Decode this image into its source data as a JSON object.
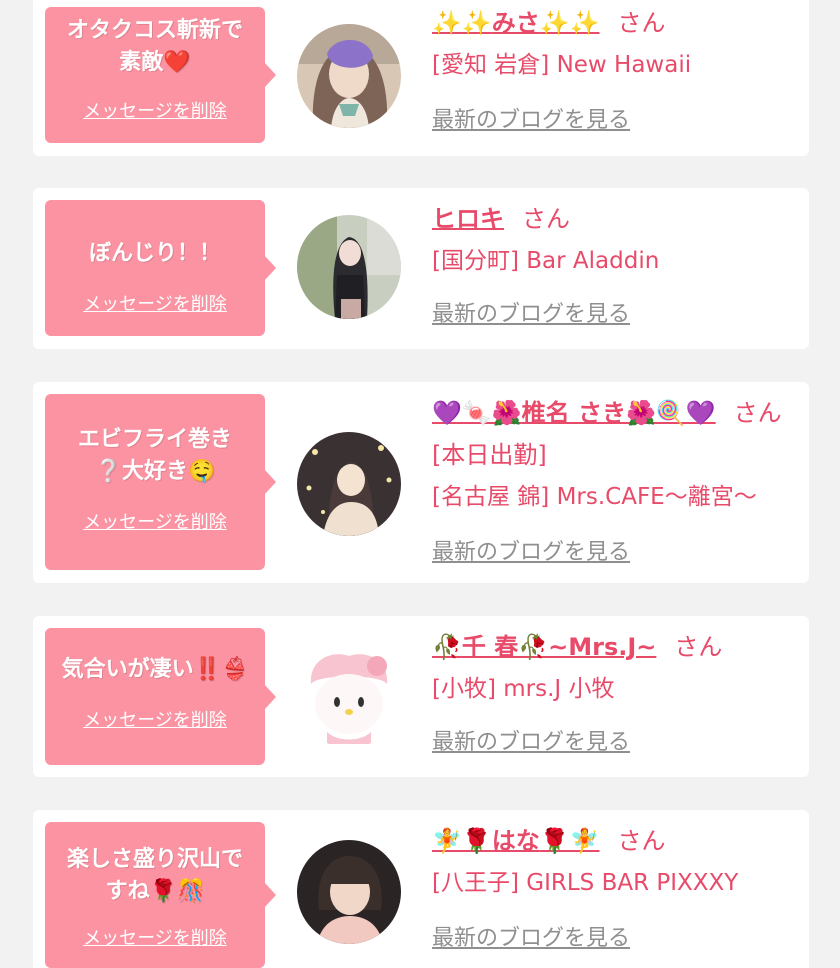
{
  "messages": [
    {
      "bubble_text": "オタクコス斬新で素敵❤️",
      "delete_label": "メッセージを削除",
      "name_pre": "✨✨",
      "name": "みさ",
      "name_post": "✨✨",
      "honorific": "さん",
      "status": "",
      "shop": "[愛知 岩倉] New Hawaii",
      "blog_label": "最新のブログを見る",
      "avatar_icon": "profile-photo-woman-long-hair",
      "avatar_colors": [
        "#7d6456",
        "#d9c7b5",
        "#8c72c8"
      ]
    },
    {
      "bubble_text": "ぼんじり！！",
      "delete_label": "メッセージを削除",
      "name_pre": "",
      "name": "ヒロキ",
      "name_post": "",
      "honorific": "さん",
      "status": "",
      "shop": "[国分町] Bar Aladdin",
      "blog_label": "最新のブログを見る",
      "avatar_icon": "profile-photo-woman-black-dress",
      "avatar_colors": [
        "#2b2b30",
        "#9aa886",
        "#e8d6d0"
      ]
    },
    {
      "bubble_text": "エビフライ巻き❔大好き🤤",
      "delete_label": "メッセージを削除",
      "name_pre": "💜🍬🌺",
      "name": "椎名 さき",
      "name_post": "🌺🍭💜",
      "honorific": "さん",
      "status": "[本日出勤]",
      "shop": "[名古屋 錦] Mrs.CAFE〜離宮〜",
      "blog_label": "最新のブログを見る",
      "avatar_icon": "profile-photo-woman-lights",
      "avatar_colors": [
        "#3a3133",
        "#f3e3d0",
        "#c9b3a3"
      ]
    },
    {
      "bubble_text": "気合いが凄い‼️👙",
      "delete_label": "メッセージを削除",
      "name_pre": "🥀",
      "name": "千 春🥀~Mrs.J~",
      "name_post": "",
      "honorific": "さん",
      "status": "",
      "shop": "[小牧] mrs.J 小牧",
      "blog_label": "最新のブログを見る",
      "avatar_icon": "profile-photo-character-plush",
      "avatar_colors": [
        "#ffffff",
        "#f7c4cf",
        "#f4a7b8"
      ]
    },
    {
      "bubble_text": "楽しさ盛り沢山ですね🌹🎊",
      "delete_label": "メッセージを削除",
      "name_pre": "🧚🌹",
      "name": "はな",
      "name_post": "🌹🧚",
      "honorific": "さん",
      "status": "",
      "shop": "[八王子] GIRLS BAR PIXXXY",
      "blog_label": "最新のブログを見る",
      "avatar_icon": "profile-photo-woman-short-hair",
      "avatar_colors": [
        "#2a2424",
        "#f1d7c8",
        "#f2c9c0"
      ]
    }
  ],
  "colors": {
    "bubble": "#fc93a2",
    "accent_text": "#e84b6a",
    "link_gray": "#8f8f8f",
    "background": "#f2f2f2"
  }
}
